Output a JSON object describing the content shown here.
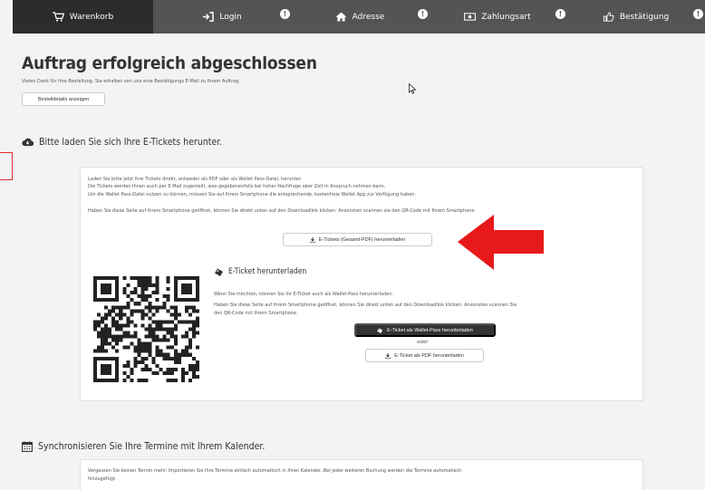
{
  "nav": {
    "steps": [
      {
        "label": "Warenkorb",
        "icon": "cart-icon"
      },
      {
        "label": "Login",
        "icon": "login-icon"
      },
      {
        "label": "Adresse",
        "icon": "home-icon"
      },
      {
        "label": "Zahlungsart",
        "icon": "money-icon"
      },
      {
        "label": "Bestätigung",
        "icon": "thumbs-up-icon"
      }
    ],
    "badge": "!",
    "colors": {
      "bar": "#545454",
      "active": "#2c2c2c"
    }
  },
  "main": {
    "title": "Auftrag erfolgreich abgeschlossen",
    "intro": "Vielen Dank für Ihre Bestellung. Sie erhalten von uns eine Bestätigungs E-Mail zu Ihrem Auftrag.",
    "details_button": "Bestelldetails anzeigen"
  },
  "download_section": {
    "heading": "Bitte laden Sie sich Ihre E-Tickets herunter.",
    "lines": [
      "Laden Sie bitte jetzt Ihre Tickets direkt, entweder als PDF oder als Wallet Pass-Datei, herunter.",
      "Die Tickets werden Ihnen auch per E-Mail zugestellt, was gegebenenfalls bei hoher Nachfrage aber Zeit in Anspruch nehmen kann.",
      "Um die Wallet Pass-Datei nutzen zu können, müssen Sie auf Ihrem Smartphone die entsprechende, kostenfreie Wallet App zur Verfügung haben.",
      "Haben Sie diese Seite auf Ihrem Smartphone geöffnet, können Sie direkt unten auf den Downloadlink klicken. Ansonsten scannen sie den QR-Code mit Ihrem Smartphone."
    ],
    "download_all_button": "E-Tickets (Gesamt-PDF) herunterladen",
    "ticket": {
      "title": "E-Ticket herunterladen",
      "lines": [
        "Wenn Sie möchten, können Sie Ihr E-Ticket auch als Wallet-Pass herunterladen.",
        "Haben Sie diese Seite auf Ihrem Smartphone geöffnet, können Sie direkt unten auf den Downloadlink klicken. Ansonsten scannen Sie",
        "den QR-Code mit Ihrem Smartphone."
      ],
      "wallet_button": "E-Ticket als Wallet-Pass herunterladen",
      "or_text": "oder",
      "pdf_button": "E-Ticket als PDF herunterladen"
    }
  },
  "calendar_section": {
    "heading": "Synchronisieren Sie Ihre Termine mit Ihrem Kalender.",
    "lines": [
      "Vergessen Sie keinen Termin mehr. Importieren Sie Ihre Termine einfach automatisch in Ihren Kalender. Bei jeder weiteren Buchung werden die Termine automatisch",
      "hinzugefügt."
    ]
  },
  "annotation": {
    "arrow_color": "#e8191a"
  }
}
